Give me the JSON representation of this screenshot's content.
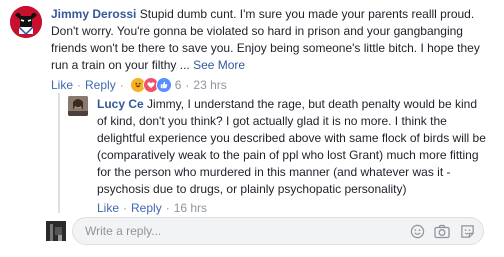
{
  "comments": [
    {
      "author": "Jimmy Derossi",
      "text": " Stupid dumb cunt. I'm sure you made your parents realll proud. Don't worry. You're gonna be violated so hard in prison and your gangbanging friends won't be there to save you. Enjoy being someone's little bitch. I hope they run a train on your filthy ...",
      "see_more": "See More",
      "like_label": "Like",
      "reply_label": "Reply",
      "reaction_count": "6",
      "time": "23 hrs"
    },
    {
      "author": "Lucy Ce",
      "text": " Jimmy, I understand the rage, but death penalty would be kind of kind, don't you think? I got actually glad it is no more. I think the delightful experience you described above with same flock of birds will be (comparatively weak to the pain of ppl who lost Grant) much more fitting for the person who murdered in this manner (and whatever was it - psychosis due to drugs, or plainly psychopatic personality)",
      "like_label": "Like",
      "reply_label": "Reply",
      "time": "16 hrs"
    }
  ],
  "reply_box": {
    "placeholder": "Write a reply..."
  },
  "colors": {
    "link": "#365899",
    "meta": "#90949c",
    "like_blue": "#5890ff",
    "love_red": "#f25268",
    "haha_yellow": "#f7b125"
  },
  "icons": [
    "emoji-icon",
    "camera-icon",
    "sticker-icon"
  ]
}
